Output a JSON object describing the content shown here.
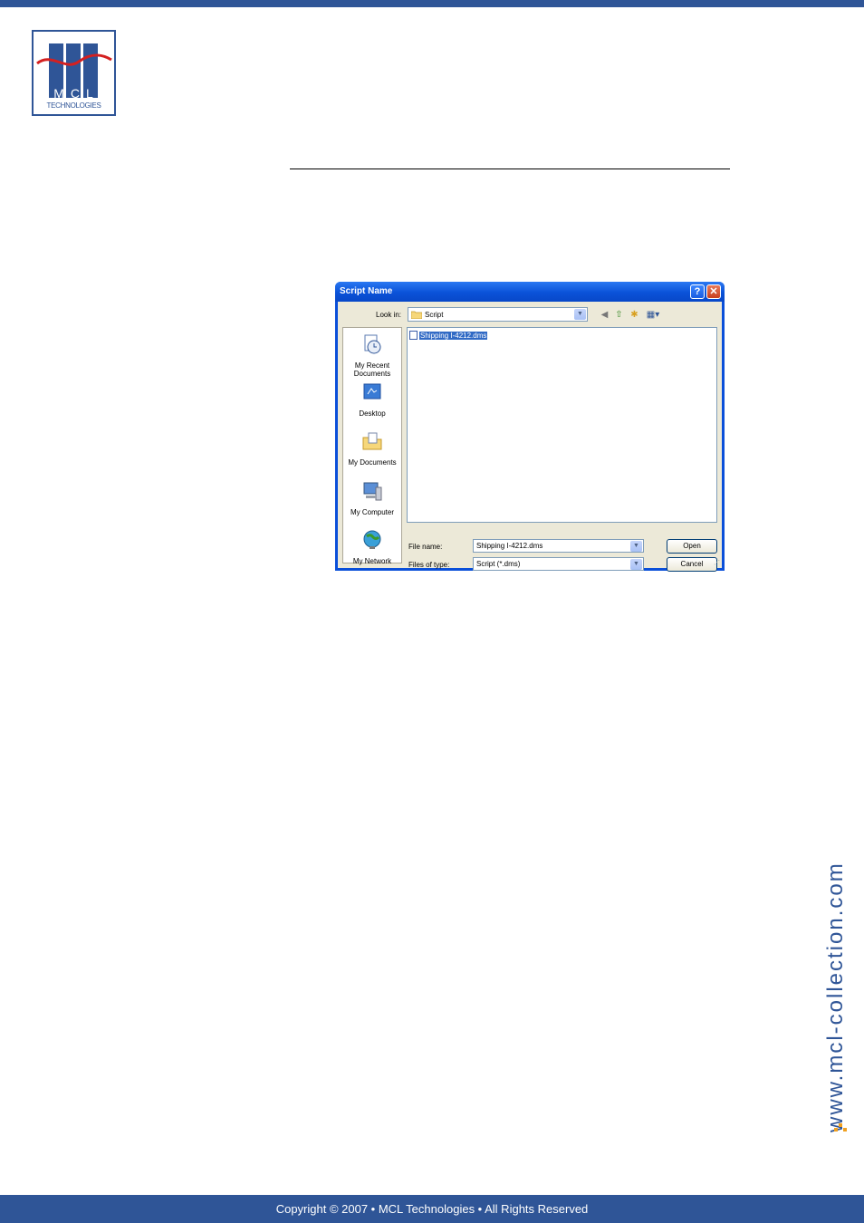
{
  "header": {
    "logo_text": "MCL",
    "logo_subtext": "TECHNOLOGIES"
  },
  "dialog": {
    "title": "Script Name",
    "help_button": "?",
    "close_button": "✕",
    "look_in_label": "Look in:",
    "look_in_value": "Script",
    "places": [
      {
        "label": "My Recent Documents"
      },
      {
        "label": "Desktop"
      },
      {
        "label": "My Documents"
      },
      {
        "label": "My Computer"
      },
      {
        "label": "My Network"
      }
    ],
    "files": [
      {
        "name": "Shipping I-4212.dms",
        "selected": true
      }
    ],
    "file_name_label": "File name:",
    "file_name_value": "Shipping I-4212.dms",
    "file_type_label": "Files of type:",
    "file_type_value": "Script (*.dms)",
    "open_button": "Open",
    "cancel_button": "Cancel"
  },
  "side_url": "www.mcl-collection.com",
  "footer": {
    "copyright": "Copyright © 2007 • MCL Technologies • All Rights Reserved"
  },
  "colors": {
    "brand_blue": "#2f5597",
    "xp_title_blue": "#0a52d8",
    "selection_blue": "#316ac5",
    "accent_orange": "#f0a020"
  }
}
